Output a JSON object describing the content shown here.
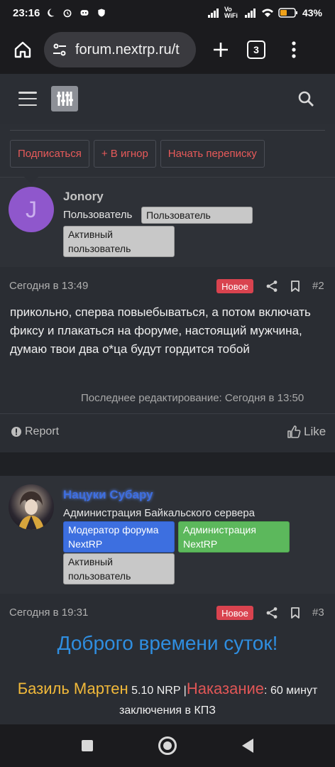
{
  "status_bar": {
    "time": "23:16",
    "battery": "43%",
    "network": "Vo WiFi"
  },
  "browser": {
    "url": "forum.nextrp.ru/t",
    "tab_count": "3"
  },
  "popup": {
    "subscribe": "Подписаться",
    "ignore": "+ В игнор",
    "message": "Начать переписку"
  },
  "post1": {
    "avatar_letter": "J",
    "username": "Jonory",
    "user_title": "Пользователь",
    "badges": [
      "Пользователь",
      "Активный пользователь"
    ],
    "date": "Сегодня в 13:49",
    "new_label": "Новое",
    "number": "#2",
    "text": "прикольно, сперва повыебываться, а потом включать фиксу и плакаться на форуме, настоящий мужчина, думаю твои два о*ца будут гордится тобой",
    "edited": "Последнее редактирование: Сегодня в 13:50",
    "report": "Report",
    "like": "Like"
  },
  "post2": {
    "username": "Нацуки Субару",
    "user_title": "Администрация Байкальского сервера",
    "badges": [
      "Модератор форума NextRP",
      "Администрация NextRP",
      "Активный пользователь"
    ],
    "date": "Сегодня в 19:31",
    "new_label": "Новое",
    "number": "#3",
    "greeting": "Доброго времени суток!",
    "name": "Базиль Мартен",
    "version": " 5.10 NRP |",
    "punishment_label": "Наказание",
    "punishment_value": ": 60 минут заключения в КПЗ"
  },
  "colors": {
    "accent_red": "#e85a5a",
    "new_badge": "#d9434f",
    "moderator_blue": "#3d6fe0",
    "admin_green": "#5cb85c",
    "greeting_blue": "#2f8ee0",
    "gold": "#f1b93a"
  },
  "icons": [
    "home-icon",
    "tune-icon",
    "plus-icon",
    "tabs-icon",
    "more-icon",
    "hamburger-icon",
    "logo-icon",
    "search-icon",
    "share-icon",
    "bookmark-icon",
    "flag-icon",
    "thumbs-up-icon"
  ]
}
